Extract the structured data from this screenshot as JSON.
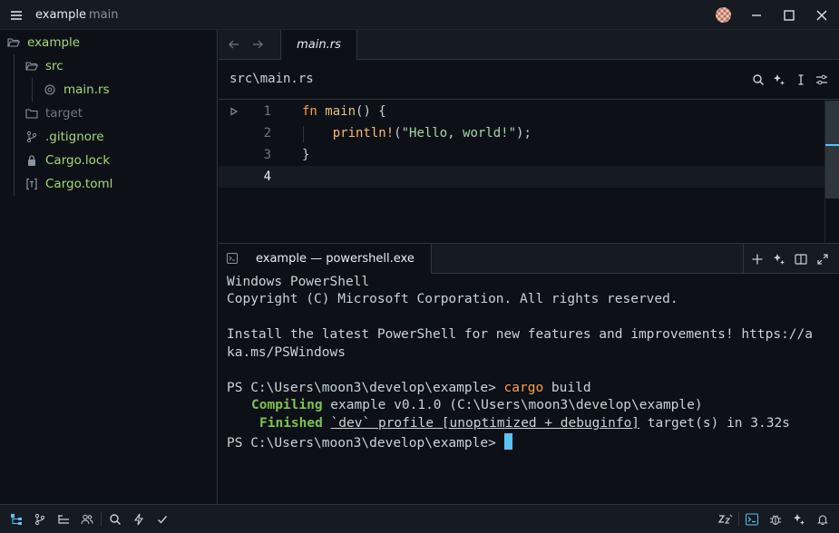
{
  "titlebar": {
    "project": "example",
    "branch": "main"
  },
  "sidebar": {
    "root": "example",
    "items": [
      {
        "label": "src",
        "icon": "folder-open-icon",
        "color": "#a3d977"
      },
      {
        "label": "main.rs",
        "icon": "rust-file-icon",
        "color": "#a3d977"
      },
      {
        "label": "target",
        "icon": "folder-icon",
        "color": "#6e7681"
      },
      {
        "label": ".gitignore",
        "icon": "git-icon",
        "color": "#a3d977"
      },
      {
        "label": "Cargo.lock",
        "icon": "lock-icon",
        "color": "#a3d977"
      },
      {
        "label": "Cargo.toml",
        "icon": "toml-file-icon",
        "color": "#a3d977"
      }
    ]
  },
  "editor": {
    "tab": "main.rs",
    "path": "src\\main.rs",
    "lines": [
      {
        "num": "1"
      },
      {
        "num": "2"
      },
      {
        "num": "3"
      },
      {
        "num": "4"
      }
    ],
    "code": {
      "l1_kw": "fn",
      "l1_name": "main",
      "l1_rest": "() {",
      "l2_macro": "println!",
      "l2_open": "(",
      "l2_str": "\"Hello, world!\"",
      "l2_close": ");",
      "l3": "}"
    }
  },
  "terminal": {
    "tab": "example — powershell.exe",
    "lines": {
      "l1": "Windows PowerShell",
      "l2": "Copyright (C) Microsoft Corporation. All rights reserved.",
      "l3": "Install the latest PowerShell for new features and improvements! https://a",
      "l4": "ka.ms/PSWindows",
      "prompt": "PS C:\\Users\\moon3\\develop\\example> ",
      "cmd": "cargo",
      "cmd_arg": " build",
      "compiling_label": "Compiling",
      "compiling_rest": " example v0.1.0 (C:\\Users\\moon3\\develop\\example)",
      "finished_label": "Finished",
      "finished_profile": "`dev` profile [unoptimized + debuginfo]",
      "finished_rest": " target(s) in 3.32s",
      "prompt2": "PS C:\\Users\\moon3\\develop\\example> "
    }
  },
  "colors": {
    "accent": "#58c4f6",
    "green": "#a3d977",
    "keyword": "#ff9e3b"
  }
}
